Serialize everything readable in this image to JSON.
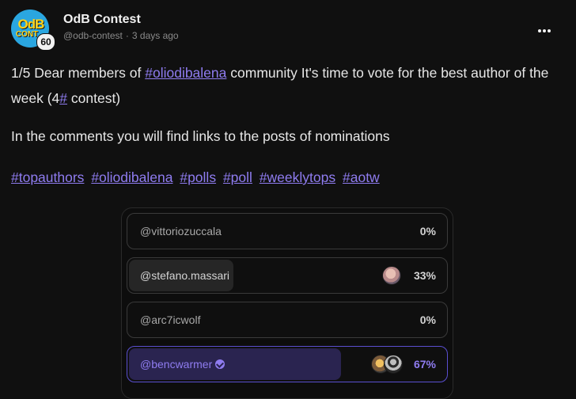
{
  "post": {
    "author": {
      "name": "OdB Contest",
      "handle": "@odb-contest",
      "time": "3 days ago",
      "level": "60",
      "avatar_text_top": "OdB",
      "avatar_text_bottom": "CONT"
    },
    "paragraph1": {
      "prefix": "1/5 Dear members of ",
      "hashtag": "#oliodibalena",
      "middle": " community It's time to vote for the best author of the week (4",
      "hash": "#",
      "suffix": " contest)"
    },
    "paragraph2": "In the comments you will find links to the posts of nominations",
    "tags": [
      "#topauthors",
      "#oliodibalena",
      "#polls",
      "#poll",
      "#weeklytops",
      "#aotw"
    ]
  },
  "poll": {
    "options": [
      {
        "label": "@vittoriozuccala",
        "percent": "0%",
        "fill": 0
      },
      {
        "label": "@stefano.massari",
        "percent": "33%",
        "fill": 0.33
      },
      {
        "label": "@arc7icwolf",
        "percent": "0%",
        "fill": 0
      },
      {
        "label": "@bencwarmer",
        "percent": "67%",
        "fill": 0.67,
        "selected": true,
        "verified": true
      }
    ]
  },
  "colors": {
    "accent": "#8f7cf0",
    "background": "#101010"
  },
  "icons": {
    "more": "more-dots-icon",
    "verified": "verified-check-icon"
  }
}
